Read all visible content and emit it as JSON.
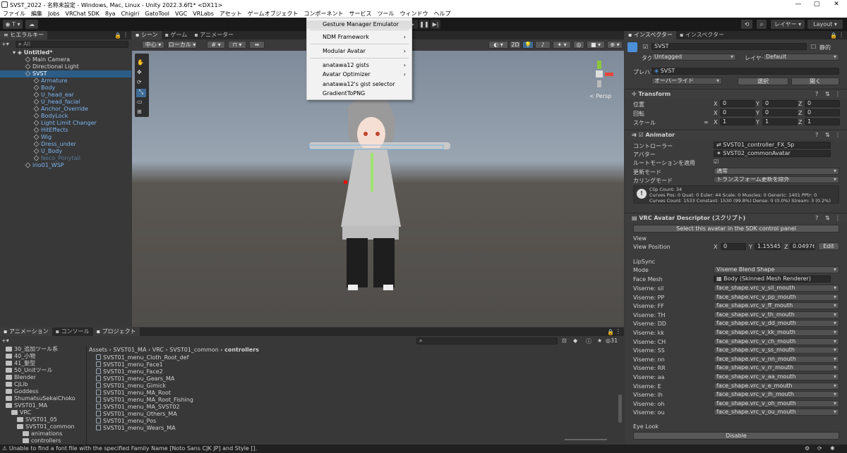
{
  "window": {
    "title": "SVST_2022 - 名称未設定 - Windows, Mac, Linux - Unity 2022.3.6f1* <DX11>"
  },
  "menubar": [
    "ファイル",
    "編集",
    "Jobs",
    "VRChat SDK",
    "8ya",
    "Chigiri",
    "GatoTool",
    "VGC",
    "VRLabs",
    "アセット",
    "ゲームオブジェクト",
    "コンポーネント",
    "サービス",
    "ツール",
    "ウィンドウ",
    "ヘルプ"
  ],
  "toolbar": {
    "account": "T",
    "layers": "レイヤー",
    "layout": "Layout"
  },
  "dropdown": {
    "items": [
      {
        "label": "Gesture Manager Emulator",
        "submenu": false
      },
      {
        "label": "NDM Framework",
        "submenu": true
      },
      {
        "label": "Modular Avatar",
        "submenu": true
      },
      {
        "label": "anatawa12 gists",
        "submenu": true
      },
      {
        "label": "Avatar Optimizer",
        "submenu": true
      },
      {
        "label": "anatawa12's gist selector",
        "submenu": false
      },
      {
        "label": "GradientToPNG",
        "submenu": false
      }
    ]
  },
  "hierarchy": {
    "tab": "ヒエラルキー",
    "search_placeholder": "All",
    "scene": "Untitled*",
    "items": [
      {
        "label": "Main Camera",
        "indent": 1,
        "blue": false,
        "sel": false
      },
      {
        "label": "Directional Light",
        "indent": 1,
        "blue": false,
        "sel": false
      },
      {
        "label": "SVST",
        "indent": 1,
        "blue": true,
        "sel": true
      },
      {
        "label": "Armature",
        "indent": 2,
        "blue": true,
        "sel": false
      },
      {
        "label": "Body",
        "indent": 2,
        "blue": true,
        "sel": false
      },
      {
        "label": "U_head_ear",
        "indent": 2,
        "blue": true,
        "sel": false
      },
      {
        "label": "U_head_facial",
        "indent": 2,
        "blue": true,
        "sel": false
      },
      {
        "label": "Anchor_Override",
        "indent": 2,
        "blue": true,
        "sel": false
      },
      {
        "label": "BodyLock",
        "indent": 2,
        "blue": true,
        "sel": false
      },
      {
        "label": "Light Limit Changer",
        "indent": 2,
        "blue": true,
        "sel": false
      },
      {
        "label": "HitEffects",
        "indent": 2,
        "blue": true,
        "sel": false
      },
      {
        "label": "Wig",
        "indent": 2,
        "blue": true,
        "sel": false
      },
      {
        "label": "Dress_under",
        "indent": 2,
        "blue": true,
        "sel": false
      },
      {
        "label": "U_Body",
        "indent": 2,
        "blue": true,
        "sel": false
      },
      {
        "label": "Neco_Ponytail",
        "indent": 2,
        "blue": true,
        "sel": false
      },
      {
        "label": "irio01_WSP",
        "indent": 1,
        "blue": true,
        "sel": false
      }
    ]
  },
  "scene": {
    "tabs": [
      "シーン",
      "ゲーム",
      "アニメーター"
    ],
    "pivot": "中心",
    "space": "ローカル",
    "mode2d": "2D",
    "persp": "< Persp"
  },
  "bottom": {
    "tabs": [
      "アニメーション",
      "コンソール",
      "プロジェクト"
    ],
    "count": "31",
    "breadcrumb": [
      "Assets",
      "SVST01_MA",
      "VRC",
      "SVST01_common",
      "controllers"
    ],
    "folders": [
      {
        "label": "30_追加ツール系",
        "indent": 1
      },
      {
        "label": "40_小物",
        "indent": 1
      },
      {
        "label": "41_髪型",
        "indent": 1
      },
      {
        "label": "50_Unitツール",
        "indent": 1
      },
      {
        "label": "Blender",
        "indent": 1
      },
      {
        "label": "CjLib",
        "indent": 1
      },
      {
        "label": "Goddess",
        "indent": 1
      },
      {
        "label": "ShumatsuSekaiChoko",
        "indent": 1
      },
      {
        "label": "SVST01_MA",
        "indent": 1
      },
      {
        "label": "VRC",
        "indent": 2
      },
      {
        "label": "SVST01_05",
        "indent": 3
      },
      {
        "label": "SVST01_common",
        "indent": 3
      },
      {
        "label": "animations",
        "indent": 4
      },
      {
        "label": "controllers",
        "indent": 4
      }
    ],
    "files": [
      "SVST01_menu_Cloth_Root_def",
      "SVST01_menu_Face1",
      "SVST01_menu_Face2",
      "SVST01_menu_Gears_MA",
      "SVST01_menu_Gimick",
      "SVST01_menu_MA_Root",
      "SVST01_menu_MA_Root_Fishing",
      "SVST01_menu_MA_SVST02",
      "SVST01_menu_Others_MA",
      "SVST01_menu_Pos",
      "SVST01_menu_Wears_MA"
    ]
  },
  "inspector": {
    "tabs": [
      "インスペクター",
      "インスペクター"
    ],
    "name": "SVST",
    "static": "静的",
    "tag_label": "タグ",
    "tag": "Untagged",
    "layer_label": "レイヤー",
    "layer": "Default",
    "prefab_label": "プレハブ",
    "prefab": "SVST",
    "override": "オーバーライド",
    "select": "選択",
    "open": "開く",
    "transform": {
      "title": "Transform",
      "rows": [
        {
          "label": "位置",
          "x": "0",
          "y": "0",
          "z": "0"
        },
        {
          "label": "回転",
          "x": "0",
          "y": "0",
          "z": "0"
        },
        {
          "label": "スケール",
          "x": "1",
          "y": "1",
          "z": "1"
        }
      ]
    },
    "animator": {
      "title": "Animator",
      "controller_label": "コントローラー",
      "controller": "SVST01_controller_FX_Sp",
      "avatar_label": "アバター",
      "avatar": "SVST02_commonAvatar",
      "root_label": "ルートモーションを適用",
      "update_label": "更新モード",
      "update": "通常",
      "culling_label": "カリングモード",
      "culling": "トランスフォーム更新を除外",
      "info": [
        "Clip Count: 34",
        "Curves Pos: 0 Quat: 0 Euler: 44 Scale: 0 Muscles: 0 Generic: 1401 PPtr: 0",
        "Curves Count: 1533 Constant: 1530 (99.8%) Dense: 0 (0.0%) Stream: 3 (0.2%)"
      ]
    },
    "vrc": {
      "title": "VRC Avatar Descriptor (スクリプト)",
      "select_btn": "Select this avatar in the SDK control panel",
      "view": "View",
      "view_position": "View Position",
      "vx": "0",
      "vy": "1.155458",
      "vz": "0.049767",
      "edit": "Edit",
      "lipsync": "LipSync",
      "mode_label": "Mode",
      "mode": "Viseme Blend Shape",
      "face_label": "Face Mesh",
      "face": "Body (Skinned Mesh Renderer)",
      "visemes": [
        {
          "l": "Viseme: sil",
          "v": "face_shape.vrc_v_sil_mouth"
        },
        {
          "l": "Viseme: PP",
          "v": "face_shape.vrc_v_pp_mouth"
        },
        {
          "l": "Viseme: FF",
          "v": "face_shape.vrc_v_ff_mouth"
        },
        {
          "l": "Viseme: TH",
          "v": "face_shape.vrc_v_th_mouth"
        },
        {
          "l": "Viseme: DD",
          "v": "face_shape.vrc_v_dd_mouth"
        },
        {
          "l": "Viseme: kk",
          "v": "face_shape.vrc_v_kk_mouth"
        },
        {
          "l": "Viseme: CH",
          "v": "face_shape.vrc_v_ch_mouth"
        },
        {
          "l": "Viseme: SS",
          "v": "face_shape.vrc_v_ss_mouth"
        },
        {
          "l": "Viseme: nn",
          "v": "face_shape.vrc_v_nn_mouth"
        },
        {
          "l": "Viseme: RR",
          "v": "face_shape.vrc_v_rr_mouth"
        },
        {
          "l": "Viseme: aa",
          "v": "face_shape.vrc_v_aa_mouth"
        },
        {
          "l": "Viseme: E",
          "v": "face_shape.vrc_v_e_mouth"
        },
        {
          "l": "Viseme: ih",
          "v": "face_shape.vrc_v_ih_mouth"
        },
        {
          "l": "Viseme: oh",
          "v": "face_shape.vrc_v_oh_mouth"
        },
        {
          "l": "Viseme: ou",
          "v": "face_shape.vrc_v_ou_mouth"
        }
      ],
      "eyelook": "Eye Look",
      "disable": "Disable"
    }
  },
  "status": "Unable to find a font file with the specified Family Name [Noto Sans CJK JP] and Style []."
}
